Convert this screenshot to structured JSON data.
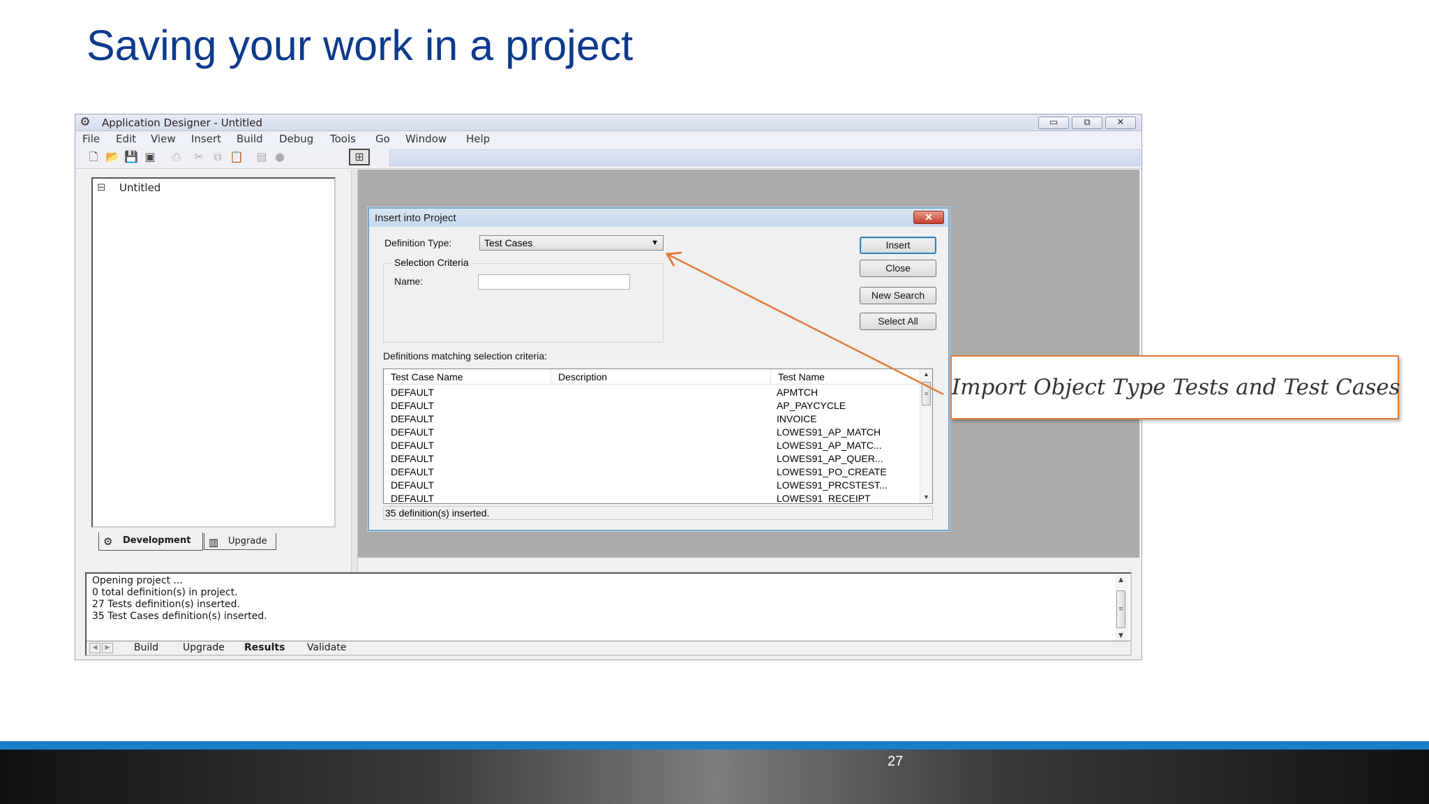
{
  "slide": {
    "title": "Saving your work in a project",
    "page_number": "27",
    "callout": "Import Object Type Tests and Test Cases",
    "colors": {
      "title": "#0d3a8c",
      "callout_border": "#e07b39",
      "footer_accent": "#1a7fc6"
    }
  },
  "app": {
    "title": "Application Designer - Untitled",
    "menu": [
      "File",
      "Edit",
      "View",
      "Insert",
      "Build",
      "Debug",
      "Tools",
      "Go",
      "Window",
      "Help"
    ],
    "toolbar_icons": [
      "new-file-icon",
      "open-folder-icon",
      "save-icon",
      "save-all-icon",
      "print-icon",
      "cut-icon",
      "copy-icon",
      "paste-icon",
      "properties-icon",
      "stop-icon",
      "project-view-icon"
    ]
  },
  "project_pane": {
    "root_item": "Untitled",
    "tabs": [
      "Development",
      "Upgrade"
    ],
    "active_tab": "Development"
  },
  "dialog": {
    "title": "Insert into Project",
    "definition_type_label": "Definition Type:",
    "definition_type_value": "Test Cases",
    "selection_criteria_label": "Selection Criteria",
    "name_label": "Name:",
    "name_value": "",
    "buttons": {
      "insert": "Insert",
      "close": "Close",
      "new_search": "New Search",
      "select_all": "Select All"
    },
    "matching_label": "Definitions matching selection criteria:",
    "columns": [
      "Test Case Name",
      "Description",
      "Test Name"
    ],
    "rows": [
      [
        "DEFAULT",
        "",
        "APMTCH"
      ],
      [
        "DEFAULT",
        "",
        "AP_PAYCYCLE"
      ],
      [
        "DEFAULT",
        "",
        "INVOICE"
      ],
      [
        "DEFAULT",
        "",
        "LOWES91_AP_MATCH"
      ],
      [
        "DEFAULT",
        "",
        "LOWES91_AP_MATC..."
      ],
      [
        "DEFAULT",
        "",
        "LOWES91_AP_QUER..."
      ],
      [
        "DEFAULT",
        "",
        "LOWES91_PO_CREATE"
      ],
      [
        "DEFAULT",
        "",
        "LOWES91_PRCSTEST..."
      ],
      [
        "DEFAULT",
        "",
        "LOWES91_RECEIPT"
      ]
    ],
    "status": "35 definition(s) inserted."
  },
  "output": {
    "lines": [
      "Opening project ...",
      "0  total definition(s) in project.",
      "27 Tests definition(s) inserted.",
      "35 Test Cases definition(s) inserted."
    ],
    "tabs": [
      "Build",
      "Upgrade",
      "Results",
      "Validate"
    ],
    "active_tab": "Results"
  }
}
